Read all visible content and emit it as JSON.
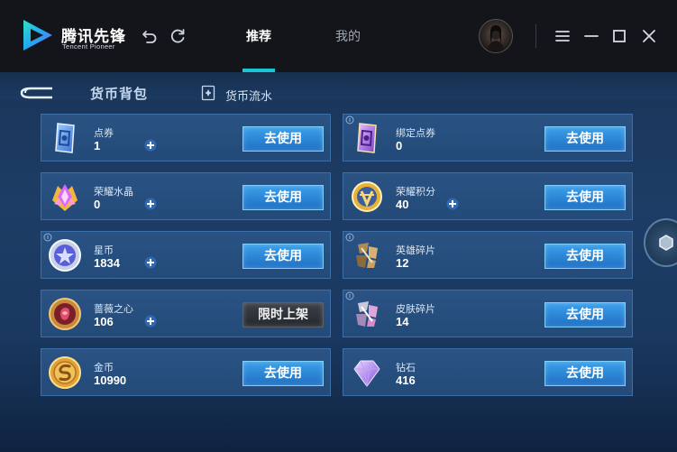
{
  "app": {
    "logo_cn": "腾讯先锋",
    "logo_en": "Tencent Pioneer"
  },
  "header": {
    "tabs": [
      {
        "label": "推荐",
        "active": true
      },
      {
        "label": "我的",
        "active": false
      }
    ]
  },
  "page": {
    "title": "货币背包",
    "flow_label": "货币流水"
  },
  "currencies": [
    {
      "name": "点券",
      "value": "1",
      "button": "去使用",
      "plus": true,
      "icon": "voucher-icon"
    },
    {
      "name": "绑定点券",
      "value": "0",
      "button": "去使用",
      "plus": false,
      "icon": "bound-voucher-icon"
    },
    {
      "name": "荣耀水晶",
      "value": "0",
      "button": "去使用",
      "plus": true,
      "icon": "glory-crystal-icon"
    },
    {
      "name": "荣耀积分",
      "value": "40",
      "button": "去使用",
      "plus": true,
      "icon": "glory-points-icon"
    },
    {
      "name": "星币",
      "value": "1834",
      "button": "去使用",
      "plus": true,
      "icon": "star-coin-icon"
    },
    {
      "name": "英雄碎片",
      "value": "12",
      "button": "去使用",
      "plus": false,
      "icon": "hero-fragment-icon"
    },
    {
      "name": "蔷薇之心",
      "value": "106",
      "button": "限时上架",
      "plus": true,
      "icon": "rose-heart-icon"
    },
    {
      "name": "皮肤碎片",
      "value": "14",
      "button": "去使用",
      "plus": false,
      "icon": "skin-fragment-icon"
    },
    {
      "name": "金币",
      "value": "10990",
      "button": "去使用",
      "plus": false,
      "icon": "gold-coin-icon"
    },
    {
      "name": "钻石",
      "value": "416",
      "button": "去使用",
      "plus": false,
      "icon": "diamond-icon"
    }
  ],
  "colors": {
    "accent": "#18c6d8",
    "button_blue": "#2a86d8",
    "card_bg": "#24497a"
  }
}
